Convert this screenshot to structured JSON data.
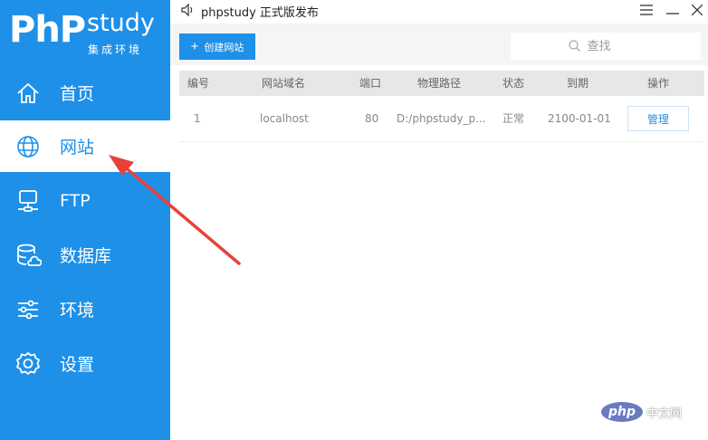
{
  "app": {
    "logo_mark": "PhP",
    "logo_word": "study",
    "logo_sub": "集成环境",
    "title": "phpstudy 正式版发布"
  },
  "sidebar": {
    "items": [
      {
        "label": "首页",
        "icon": "home-icon",
        "active": false
      },
      {
        "label": "网站",
        "icon": "globe-icon",
        "active": true
      },
      {
        "label": "FTP",
        "icon": "server-icon",
        "active": false
      },
      {
        "label": "数据库",
        "icon": "database-icon",
        "active": false
      },
      {
        "label": "环境",
        "icon": "sliders-icon",
        "active": false
      },
      {
        "label": "设置",
        "icon": "gear-icon",
        "active": false
      }
    ]
  },
  "toolbar": {
    "create_label": "创建网站",
    "search_placeholder": "查找"
  },
  "table": {
    "headers": [
      "编号",
      "网站域名",
      "端口",
      "物理路径",
      "状态",
      "到期",
      "操作"
    ],
    "rows": [
      {
        "id": "1",
        "domain": "localhost",
        "port": "80",
        "path": "D:/phpstudy_p...",
        "status": "正常",
        "expiry": "2100-01-01",
        "action": "管理"
      }
    ]
  },
  "watermark": {
    "logo": "php",
    "text": "中文网"
  },
  "colors": {
    "accent": "#1e90e8",
    "annotation": "#e8413a"
  }
}
